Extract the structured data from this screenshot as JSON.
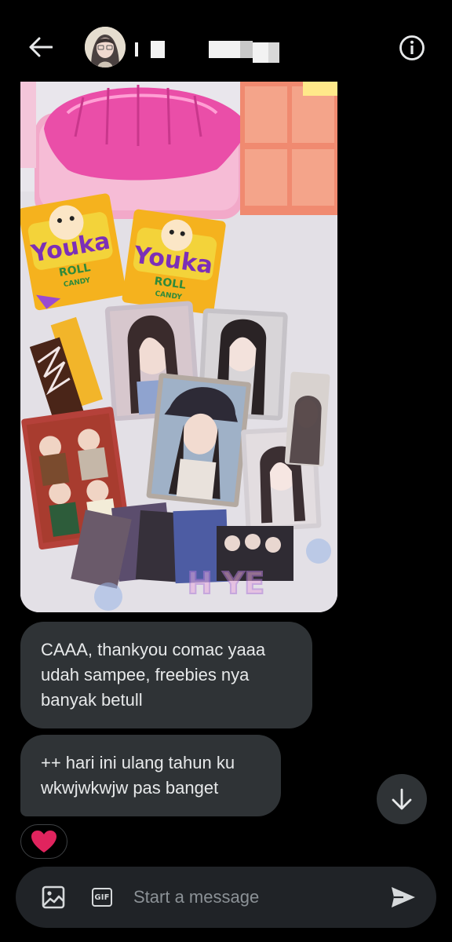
{
  "header": {
    "back_icon": "arrow-left-icon",
    "info_icon": "info-icon",
    "name_redacted": true
  },
  "photo": {
    "description_icon": "photo-attachment",
    "watermark_visible": true,
    "candy_brand": "Youka",
    "candy_sub": "ROLL",
    "candy_type": "CANDY"
  },
  "messages": [
    {
      "lines": [
        "CAAA, thankyou comac yaaa",
        "udah sampee, freebies nya",
        "banyak betull"
      ]
    },
    {
      "lines": [
        "++ hari ini ulang tahun ku",
        "wkwjwkwjw pas banget"
      ]
    }
  ],
  "reaction": {
    "icon": "heart-icon",
    "color": "#e0245e"
  },
  "composer": {
    "placeholder": "Start a message",
    "value": "",
    "gif_label": "GIF",
    "media_icon": "image-icon",
    "send_icon": "send-icon"
  },
  "colors": {
    "background": "#000000",
    "bubble": "#2f3336",
    "composer": "#202327",
    "text": "#e7e9ea",
    "placeholder": "#8b9196"
  }
}
